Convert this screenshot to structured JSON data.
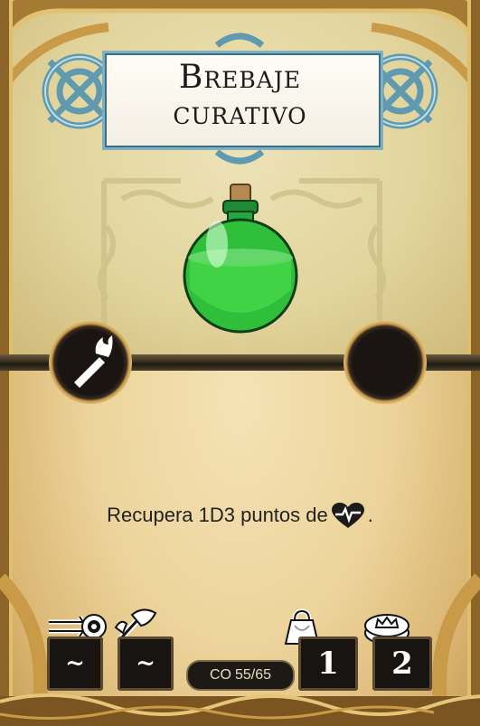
{
  "card": {
    "title_line1": "Brebaje",
    "title_line2": "curativo",
    "description_prefix": "Recupera 1D3 puntos de",
    "description_icon": "heart-pulse-icon",
    "description_suffix": ".",
    "left_slot_icon": "torch-icon",
    "right_slot_icon": "empty-slot"
  },
  "stats": {
    "ranged_icon": "arrow-target-icon",
    "ranged_value": "~",
    "melee_icon": "axe-hand-icon",
    "melee_value": "~",
    "weight_icon": "weight-icon",
    "weight_value": "1",
    "cost_icon": "coin-crown-icon",
    "cost_value": "2",
    "co_label": "CO",
    "co_value": "55/65"
  },
  "colors": {
    "potion": "#2fbf3a",
    "frame_blue": "#7fb0c2",
    "gold": "#c99a48"
  }
}
